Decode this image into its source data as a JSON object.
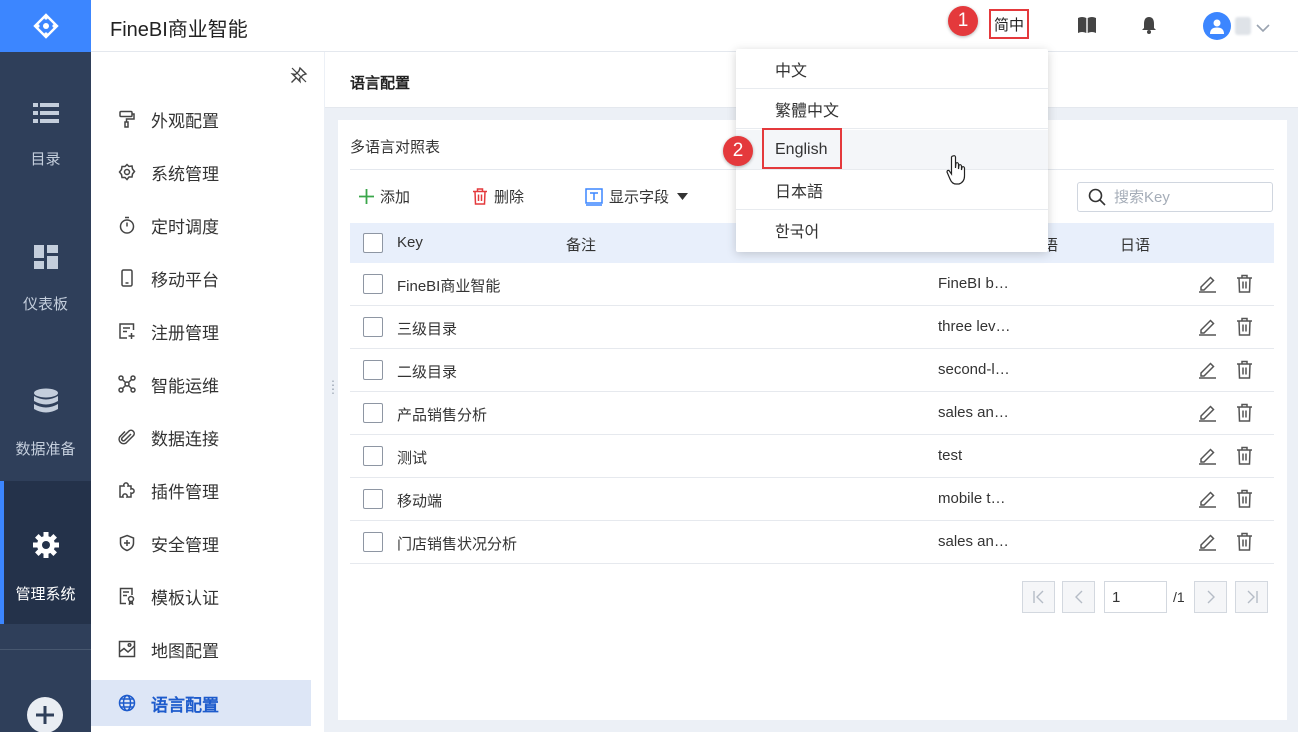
{
  "app": {
    "title": "FineBI商业智能",
    "lang_button": "简中",
    "accent": "#3c86ff",
    "marker_color": "#e4393c"
  },
  "markers": [
    "1",
    "2"
  ],
  "leftnav": [
    {
      "label": "目录",
      "icon": "list-icon"
    },
    {
      "label": "仪表板",
      "icon": "dashboard-icon"
    },
    {
      "label": "数据准备",
      "icon": "database-icon"
    },
    {
      "label": "管理系统",
      "icon": "gear-icon",
      "active": true
    }
  ],
  "sidebar": [
    {
      "label": "外观配置",
      "icon": "paint-roller-icon"
    },
    {
      "label": "系统管理",
      "icon": "settings-icon"
    },
    {
      "label": "定时调度",
      "icon": "stopwatch-icon"
    },
    {
      "label": "移动平台",
      "icon": "mobile-icon"
    },
    {
      "label": "注册管理",
      "icon": "register-icon"
    },
    {
      "label": "智能运维",
      "icon": "network-icon"
    },
    {
      "label": "数据连接",
      "icon": "paperclip-icon"
    },
    {
      "label": "插件管理",
      "icon": "puzzle-icon"
    },
    {
      "label": "安全管理",
      "icon": "shield-icon"
    },
    {
      "label": "模板认证",
      "icon": "certificate-icon"
    },
    {
      "label": "地图配置",
      "icon": "map-icon"
    },
    {
      "label": "语言配置",
      "icon": "globe-icon",
      "active": true
    }
  ],
  "page": {
    "title": "语言配置",
    "card_title": "多语言对照表"
  },
  "toolbar": {
    "add": "添加",
    "delete": "删除",
    "fields": "显示字段",
    "search_placeholder": "搜索Key"
  },
  "table": {
    "headers": {
      "key": "Key",
      "note": "备注",
      "en": "语",
      "jp": "日语"
    },
    "rows": [
      {
        "key": "FineBI商业智能",
        "en": "FineBI b…"
      },
      {
        "key": "三级目录",
        "en": "three lev…"
      },
      {
        "key": "二级目录",
        "en": "second-l…"
      },
      {
        "key": "产品销售分析",
        "en": "sales an…"
      },
      {
        "key": "测试",
        "en": "test"
      },
      {
        "key": "移动端",
        "en": "mobile t…"
      },
      {
        "key": "门店销售状况分析",
        "en": "sales an…"
      }
    ]
  },
  "pagination": {
    "current": "1",
    "total": "/1"
  },
  "language_menu": [
    "中文",
    "繁體中文",
    "English",
    "日本語",
    "한국어"
  ]
}
